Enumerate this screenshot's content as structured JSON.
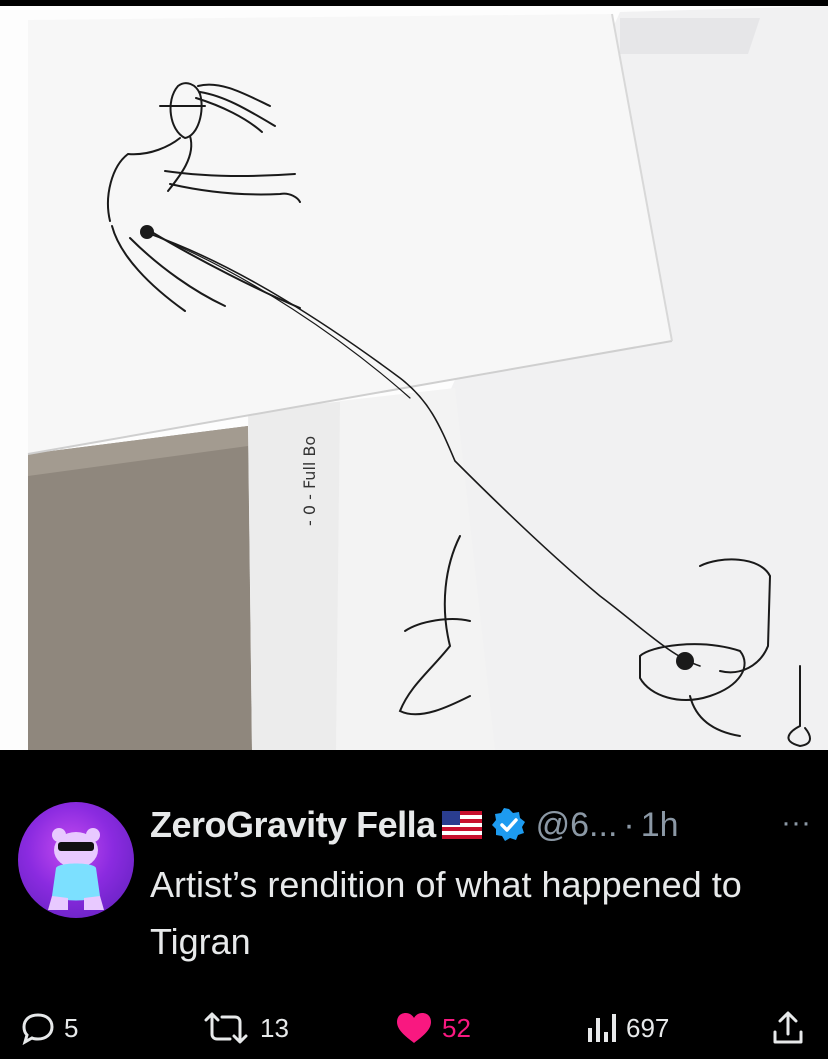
{
  "media": {
    "image_kind": "photo of pen sketches on paper",
    "side_text": "- 0 - Full Bo"
  },
  "tweet": {
    "author": {
      "display_name": "ZeroGravity Fella",
      "flag": "us-flag-icon",
      "verified": true,
      "handle": "@6...",
      "time": "1h",
      "separator": "·"
    },
    "text": "Artist’s rendition of what happened to Tigran",
    "more_label": "···",
    "actions": {
      "reply_count": "5",
      "retweet_count": "13",
      "like_count": "52",
      "view_count": "697"
    }
  },
  "colors": {
    "background": "#000000",
    "text": "#e7e9ea",
    "secondary": "#8b98a5",
    "like": "#f91880",
    "verified": "#1d9bf0"
  }
}
